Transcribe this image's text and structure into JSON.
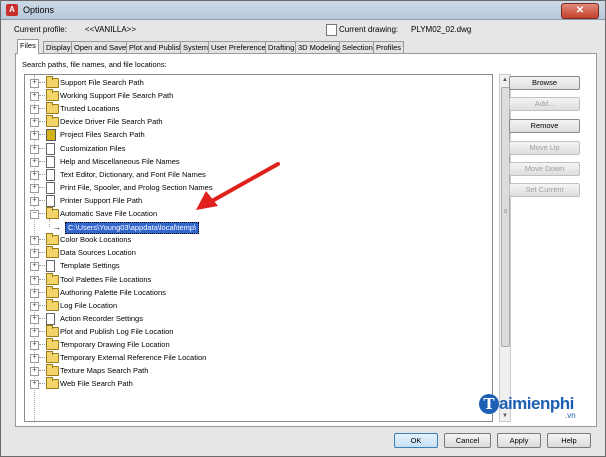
{
  "window": {
    "title": "Options",
    "app_icon": "autocad-a-icon",
    "close_glyph": "✕",
    "icon_letter": "A"
  },
  "profile": {
    "label": "Current profile:",
    "value": "<<VANILLA>>"
  },
  "drawing": {
    "label": "Current drawing:",
    "value": "PLYM02_02.dwg"
  },
  "tabs": [
    "Files",
    "Display",
    "Open and Save",
    "Plot and Publish",
    "System",
    "User Preferences",
    "Drafting",
    "3D Modeling",
    "Selection",
    "Profiles"
  ],
  "panel": {
    "label": "Search paths, file names, and file locations:"
  },
  "tree": {
    "items": [
      {
        "label": "Support File Search Path",
        "icon": "folder"
      },
      {
        "label": "Working Support File Search Path",
        "icon": "folder"
      },
      {
        "label": "Trusted Locations",
        "icon": "folder"
      },
      {
        "label": "Device Driver File Search Path",
        "icon": "folder"
      },
      {
        "label": "Project Files Search Path",
        "icon": "project"
      },
      {
        "label": "Customization Files",
        "icon": "doc"
      },
      {
        "label": "Help and Miscellaneous File Names",
        "icon": "doc"
      },
      {
        "label": "Text Editor, Dictionary, and Font File Names",
        "icon": "doc"
      },
      {
        "label": "Print File, Spooler, and Prolog Section Names",
        "icon": "doc"
      },
      {
        "label": "Printer Support File Path",
        "icon": "doc"
      },
      {
        "label": "Automatic Save File Location",
        "icon": "folder",
        "expanded": true
      },
      {
        "label": "Color Book Locations",
        "icon": "folder"
      },
      {
        "label": "Data Sources Location",
        "icon": "folder"
      },
      {
        "label": "Template Settings",
        "icon": "doc"
      },
      {
        "label": "Tool Palettes File Locations",
        "icon": "folder"
      },
      {
        "label": "Authoring Palette File Locations",
        "icon": "folder"
      },
      {
        "label": "Log File Location",
        "icon": "folder"
      },
      {
        "label": "Action Recorder Settings",
        "icon": "doc"
      },
      {
        "label": "Plot and Publish Log File Location",
        "icon": "folder"
      },
      {
        "label": "Temporary Drawing File Location",
        "icon": "folder"
      },
      {
        "label": "Temporary External Reference File Location",
        "icon": "folder"
      },
      {
        "label": "Texture Maps Search Path",
        "icon": "folder"
      },
      {
        "label": "Web File Search Path",
        "icon": "folder"
      }
    ],
    "selected_child": "C:\\Users\\Young03\\appdata\\local\\temp\\"
  },
  "buttons": {
    "browse": "Browse",
    "add": "Add...",
    "remove": "Remove",
    "move_up": "Move Up",
    "move_down": "Move Down",
    "set_current": "Set Current"
  },
  "footer": {
    "ok": "OK",
    "cancel": "Cancel",
    "apply": "Apply",
    "help": "Help"
  },
  "watermark": {
    "initial": "T",
    "name": "aimienphi",
    "tld": ".vn"
  },
  "colors": {
    "selection": "#3366cc",
    "arrow": "#e0201a",
    "watermark": "#1d5fb4"
  }
}
